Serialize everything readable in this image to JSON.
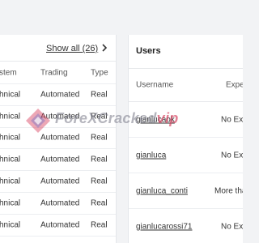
{
  "left_panel": {
    "show_all_label": "Show all (26)",
    "columns": [
      "stem",
      "Trading",
      "Type"
    ],
    "rows": [
      {
        "system": "hnical",
        "trading": "Automated",
        "type": "Real"
      },
      {
        "system": "hnical",
        "trading": "Automated",
        "type": "Real"
      },
      {
        "system": "hnical",
        "trading": "Automated",
        "type": "Real"
      },
      {
        "system": "hnical",
        "trading": "Automated",
        "type": "Real"
      },
      {
        "system": "hnical",
        "trading": "Automated",
        "type": "Real"
      },
      {
        "system": "hnical",
        "trading": "Automated",
        "type": "Real"
      },
      {
        "system": "hnical",
        "trading": "Automated",
        "type": "Real"
      }
    ]
  },
  "right_panel": {
    "title": "Users",
    "columns": [
      "Username",
      "Expe"
    ],
    "rows": [
      {
        "username": "gianlucaok",
        "experience": "No Exp"
      },
      {
        "username": "gianluca",
        "experience": "No Exp"
      },
      {
        "username": "gianluca_conti",
        "experience": "More tha"
      },
      {
        "username": "gianlucarossi71",
        "experience": "No Exp"
      }
    ]
  },
  "watermark": {
    "text_main": "ForeXCracked",
    "text_accent": "vip"
  },
  "icons": {
    "chevron": "chevron-right-icon",
    "watermark_logo": "diamond-logo-icon"
  }
}
